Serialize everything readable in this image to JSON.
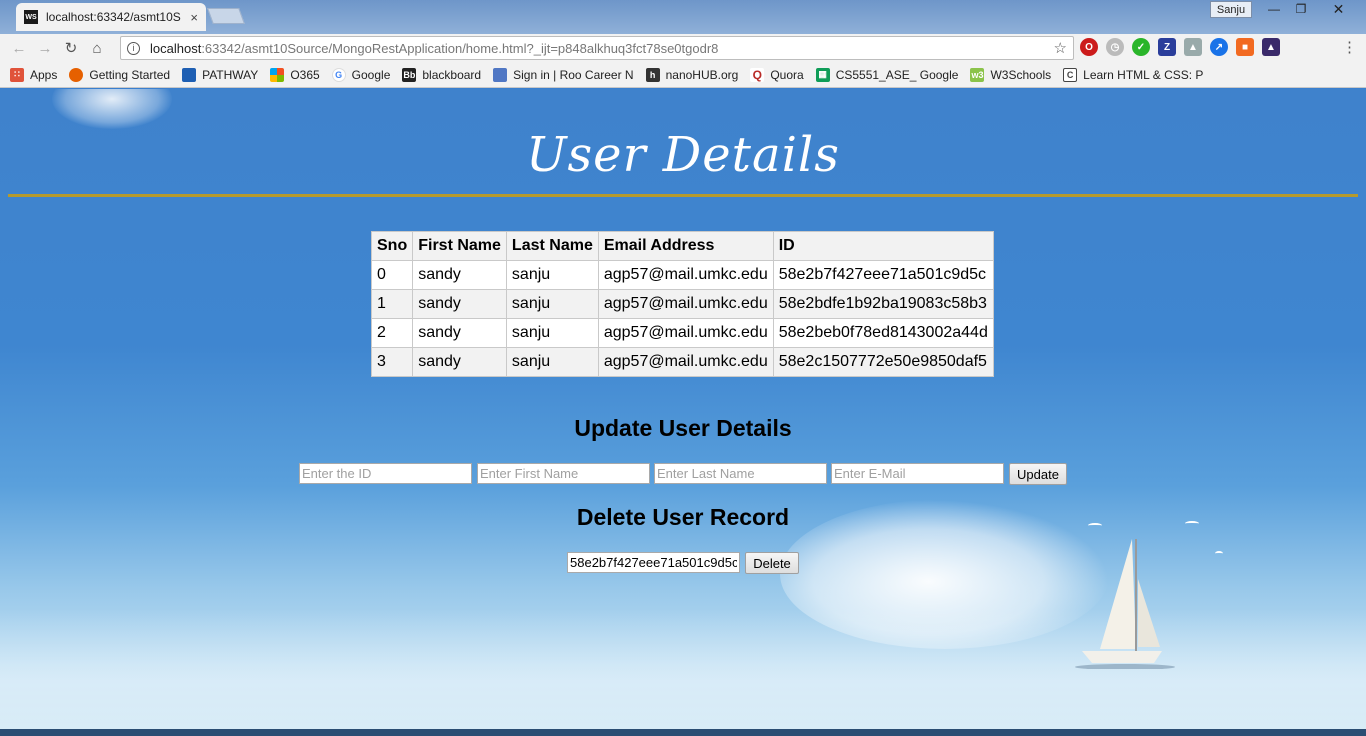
{
  "browser": {
    "tab_title": "localhost:63342/asmt10S",
    "tab_favicon": "WS",
    "tab_close": "×",
    "user_badge": "Sanju",
    "url_host": "localhost",
    "url_rest": ":63342/asmt10Source/MongoRestApplication/home.html?_ijt=p848alkhuq3fct78se0tgodr8",
    "bookmarks": [
      {
        "label": "Apps",
        "icon": "apps-grid-icon",
        "color": "#e0533a"
      },
      {
        "label": "Getting Started",
        "icon": "firefox-icon",
        "color": "#e66000"
      },
      {
        "label": "PATHWAY",
        "icon": "pathway-icon",
        "color": "#1e5fb3"
      },
      {
        "label": "O365",
        "icon": "office-icon",
        "color": "#e74c1c"
      },
      {
        "label": "Google",
        "icon": "google-icon",
        "color": "#4285f4"
      },
      {
        "label": "blackboard",
        "icon": "blackboard-icon",
        "color": "#222222"
      },
      {
        "label": "Sign in | Roo Career N",
        "icon": "bookmark-page-icon",
        "color": "#5077c4"
      },
      {
        "label": "nanoHUB.org",
        "icon": "nanohub-icon",
        "color": "#333333"
      },
      {
        "label": "Quora",
        "icon": "quora-icon",
        "color": "#b92b27"
      },
      {
        "label": "CS5551_ASE_ Google",
        "icon": "sheets-icon",
        "color": "#0f9d58"
      },
      {
        "label": "W3Schools",
        "icon": "w3schools-icon",
        "color": "#8bc34a"
      },
      {
        "label": "Learn HTML & CSS: P",
        "icon": "codecademy-icon",
        "color": "#444444"
      }
    ]
  },
  "page": {
    "title": "User Details",
    "table": {
      "headers": [
        "Sno",
        "First Name",
        "Last Name",
        "Email Address",
        "ID"
      ],
      "rows": [
        [
          "0",
          "sandy",
          "sanju",
          "agp57@mail.umkc.edu",
          "58e2b7f427eee71a501c9d5c"
        ],
        [
          "1",
          "sandy",
          "sanju",
          "agp57@mail.umkc.edu",
          "58e2bdfe1b92ba19083c58b3"
        ],
        [
          "2",
          "sandy",
          "sanju",
          "agp57@mail.umkc.edu",
          "58e2beb0f78ed8143002a44d"
        ],
        [
          "3",
          "sandy",
          "sanju",
          "agp57@mail.umkc.edu",
          "58e2c1507772e50e9850daf5"
        ]
      ]
    },
    "update": {
      "heading": "Update User Details",
      "id_placeholder": "Enter the ID",
      "first_name_placeholder": "Enter First Name",
      "last_name_placeholder": "Enter Last Name",
      "email_placeholder": "Enter E-Mail",
      "button_label": "Update"
    },
    "delete": {
      "heading": "Delete User Record",
      "id_value": "58e2b7f427eee71a501c9d5c",
      "button_label": "Delete"
    }
  }
}
